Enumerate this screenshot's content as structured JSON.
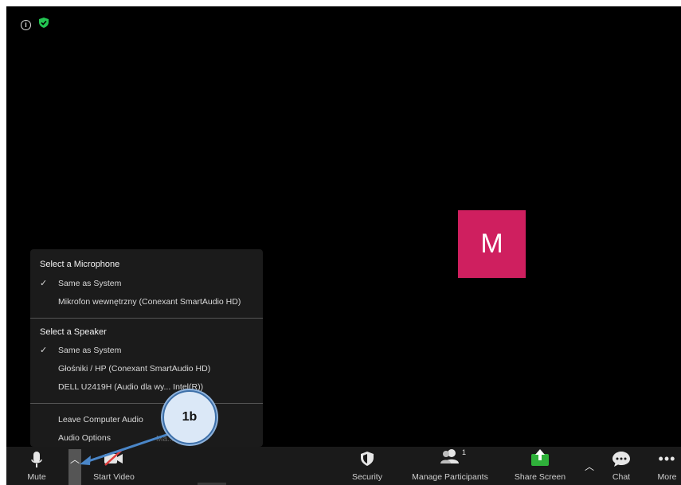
{
  "audio_menu": {
    "mic_heading": "Select a Microphone",
    "mic_options": [
      {
        "label": "Same as System",
        "checked": true
      },
      {
        "label": "Mikrofon wewnętrzny (Conexant SmartAudio HD)",
        "checked": false
      }
    ],
    "speaker_heading": "Select a Speaker",
    "speaker_options": [
      {
        "label": "Same as System",
        "checked": true
      },
      {
        "label": "Głośniki / HP (Conexant SmartAudio HD)",
        "checked": false
      },
      {
        "label": "DELL U2419H (Audio dla wy... Intel(R))",
        "checked": false
      }
    ],
    "actions": [
      "Leave Computer Audio",
      "Audio Options"
    ],
    "check_glyph": "✓"
  },
  "participant": {
    "initial": "M",
    "color": "#cf1f5f"
  },
  "toolbar": {
    "mute": "Mute",
    "start_video": "Start Video",
    "security": "Security",
    "manage_participants": "Manage Participants",
    "participant_count": "1",
    "share_screen": "Share Screen",
    "chat": "Chat",
    "more": "More"
  },
  "annotation": {
    "label": "1b"
  },
  "ghost_text": "Ma... ...iec",
  "icons": [
    "info-icon",
    "shield-check-icon",
    "microphone-icon",
    "caret-up-icon",
    "video-off-icon",
    "security-shield-icon",
    "participants-icon",
    "share-screen-icon",
    "chat-icon",
    "more-dots-icon"
  ],
  "colors": {
    "share_green": "#2fb13a",
    "video_off_red": "#e03c3c",
    "shield_green": "#23c552"
  }
}
